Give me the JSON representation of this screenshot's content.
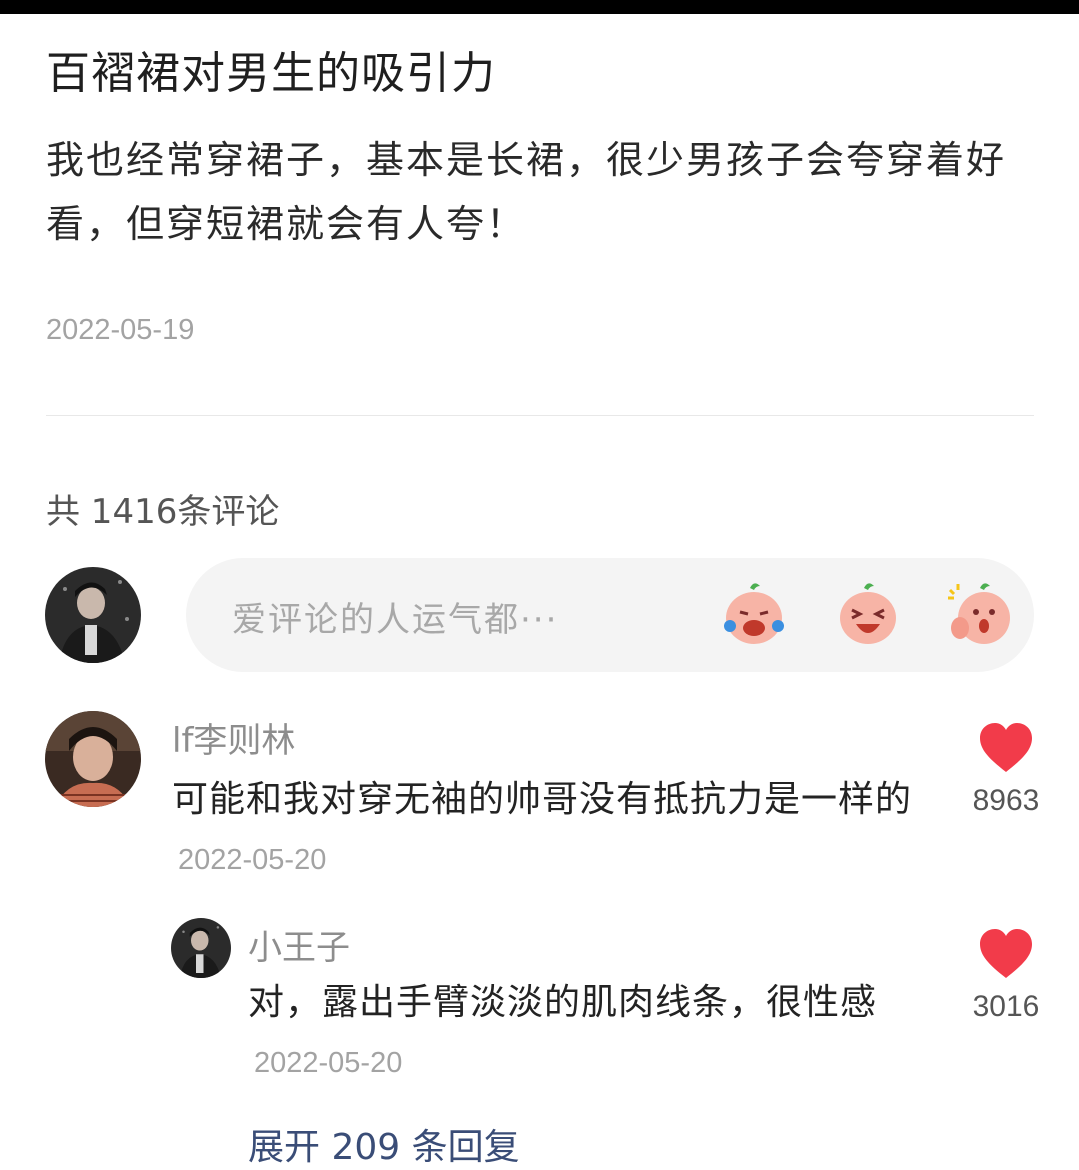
{
  "post": {
    "title": "百褶裙对男生的吸引力",
    "body": "我也经常穿裙子，基本是长裙，很少男孩子会夸穿着好看，但穿短裙就会有人夸！",
    "date": "2022-05-19"
  },
  "comments_section": {
    "count_label": "共 1416条评论",
    "input_placeholder": "爱评论的人运气都···",
    "emoji_buttons": [
      "crying-laughing-emoji",
      "laughing-emoji",
      "thumbs-up-emoji"
    ]
  },
  "comments": [
    {
      "author": "lf李则林",
      "text": "可能和我对穿无袖的帅哥没有抵抗力是一样的",
      "date": "2022-05-20",
      "likes": "8963"
    }
  ],
  "replies": [
    {
      "author": "小王子",
      "text": "对，露出手臂淡淡的肌肉线条，很性感",
      "date": "2022-05-20",
      "likes": "3016"
    }
  ],
  "expand_replies_label": "展开 209 条回复",
  "colors": {
    "like_red": "#f23b4a",
    "link_blue": "#3a4d77"
  }
}
